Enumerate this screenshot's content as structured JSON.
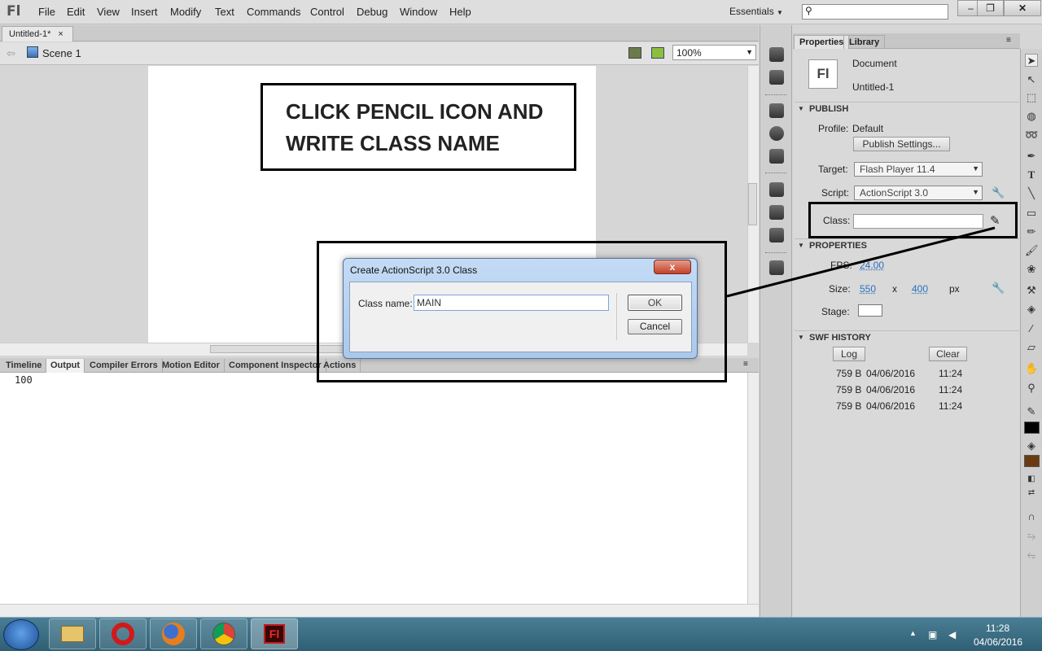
{
  "app": {
    "logo": "Fl"
  },
  "menu": [
    "File",
    "Edit",
    "View",
    "Insert",
    "Modify",
    "Text",
    "Commands",
    "Control",
    "Debug",
    "Window",
    "Help"
  ],
  "workspace": {
    "label": "Essentials",
    "search_placeholder": ""
  },
  "window_controls": {
    "minimize": "–",
    "restore": "❐",
    "close": "✕"
  },
  "document_tab": {
    "title": "Untitled-1*",
    "close": "×"
  },
  "scene": {
    "label": "Scene 1"
  },
  "zoom": {
    "value": "100%"
  },
  "annotation1": {
    "line1": "CLICK PENCIL ICON AND",
    "line2": "WRITE CLASS NAME"
  },
  "bottom_tabs": [
    "Timeline",
    "Output",
    "Compiler Errors",
    "Motion Editor",
    "Component Inspector",
    "Actions"
  ],
  "output": {
    "text": "100"
  },
  "properties_panel": {
    "tabs": [
      "Properties",
      "Library"
    ],
    "doc_icon": "Fl",
    "doc_type": "Document",
    "doc_name": "Untitled-1",
    "publish_section": "PUBLISH",
    "profile_label": "Profile:",
    "profile_value": "Default",
    "publish_settings_button": "Publish Settings...",
    "target_label": "Target:",
    "target_value": "Flash Player 11.4",
    "script_label": "Script:",
    "script_value": "ActionScript 3.0",
    "class_label": "Class:",
    "class_value": "",
    "properties_section": "PROPERTIES",
    "fps_label": "FPS:",
    "fps_value": "24.00",
    "size_label": "Size:",
    "width": "550",
    "x_sep": "x",
    "height": "400",
    "unit": "px",
    "stage_label": "Stage:",
    "stage_color": "#ffffff",
    "history_section": "SWF HISTORY",
    "log_button": "Log",
    "clear_button": "Clear",
    "history": [
      {
        "size": "759 B",
        "date": "04/06/2016",
        "time": "11:24"
      },
      {
        "size": "759 B",
        "date": "04/06/2016",
        "time": "11:24"
      },
      {
        "size": "759 B",
        "date": "04/06/2016",
        "time": "11:24"
      }
    ]
  },
  "dialog": {
    "title": "Create ActionScript 3.0 Class",
    "close": "x",
    "class_name_label": "Class name:",
    "class_name_value": "MAIN",
    "ok_button": "OK",
    "cancel_button": "Cancel"
  },
  "taskbar": {
    "time": "11:28",
    "date": "04/06/2016",
    "flash_icon": "Fl"
  }
}
